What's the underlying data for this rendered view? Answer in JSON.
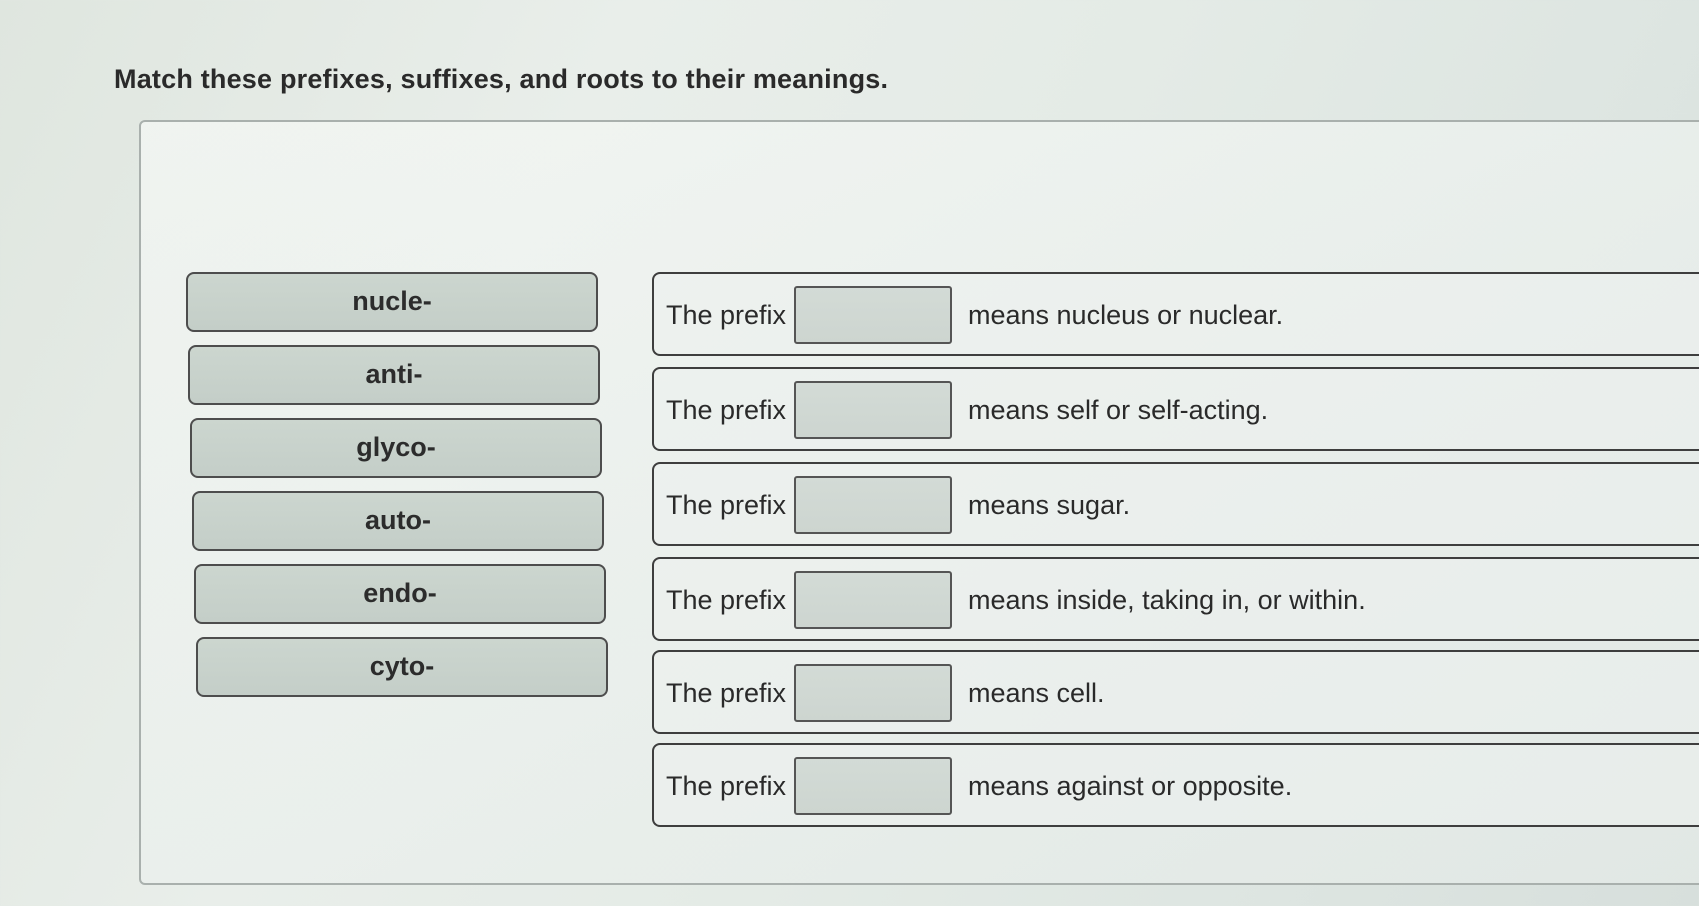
{
  "title": "Match these prefixes, suffixes, and roots to their meanings.",
  "tiles": [
    {
      "label": "nucle-"
    },
    {
      "label": "anti-"
    },
    {
      "label": "glyco-"
    },
    {
      "label": "auto-"
    },
    {
      "label": "endo-"
    },
    {
      "label": "cyto-"
    }
  ],
  "rows": [
    {
      "prefix_text": "The prefix",
      "meaning": "means nucleus or nuclear."
    },
    {
      "prefix_text": "The prefix",
      "meaning": "means self or self-acting."
    },
    {
      "prefix_text": "The prefix",
      "meaning": "means sugar."
    },
    {
      "prefix_text": "The prefix",
      "meaning": "means inside, taking in, or within."
    },
    {
      "prefix_text": "The prefix",
      "meaning": "means cell."
    },
    {
      "prefix_text": "The prefix",
      "meaning": "means against or opposite."
    }
  ]
}
